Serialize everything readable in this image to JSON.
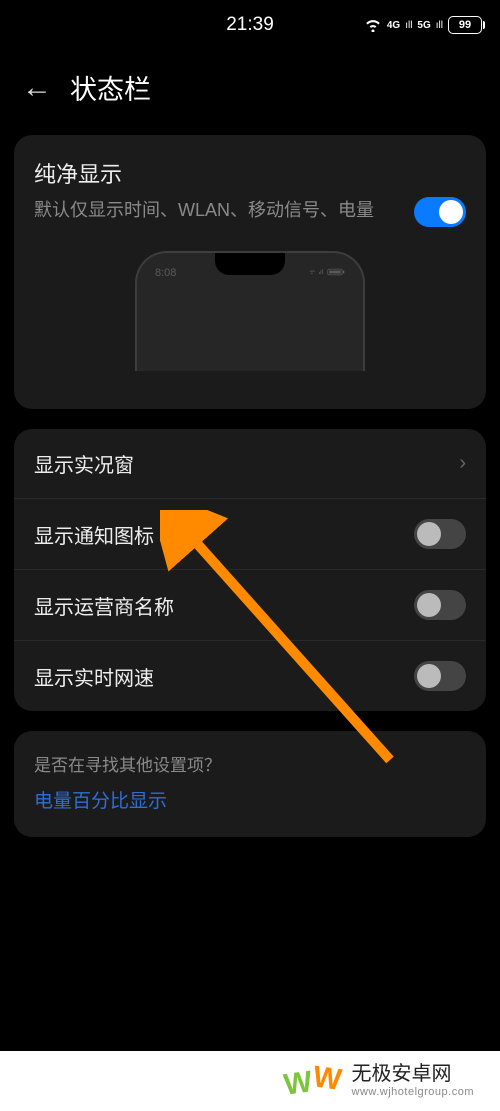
{
  "statusbar": {
    "time": "21:39",
    "net1": "4G",
    "net2": "5G",
    "battery": "99"
  },
  "header": {
    "title": "状态栏"
  },
  "clean_display": {
    "title": "纯净显示",
    "desc": "默认仅显示时间、WLAN、移动信号、电量",
    "on": true,
    "preview_time": "8:08"
  },
  "rows": {
    "live_window": "显示实况窗",
    "notif_icons": "显示通知图标",
    "carrier_name": "显示运营商名称",
    "net_speed": "显示实时网速"
  },
  "hint": {
    "q": "是否在寻找其他设置项？",
    "link": "电量百分比显示"
  },
  "footer": {
    "name": "无极安卓网",
    "url": "www.wjhotelgroup.com"
  }
}
